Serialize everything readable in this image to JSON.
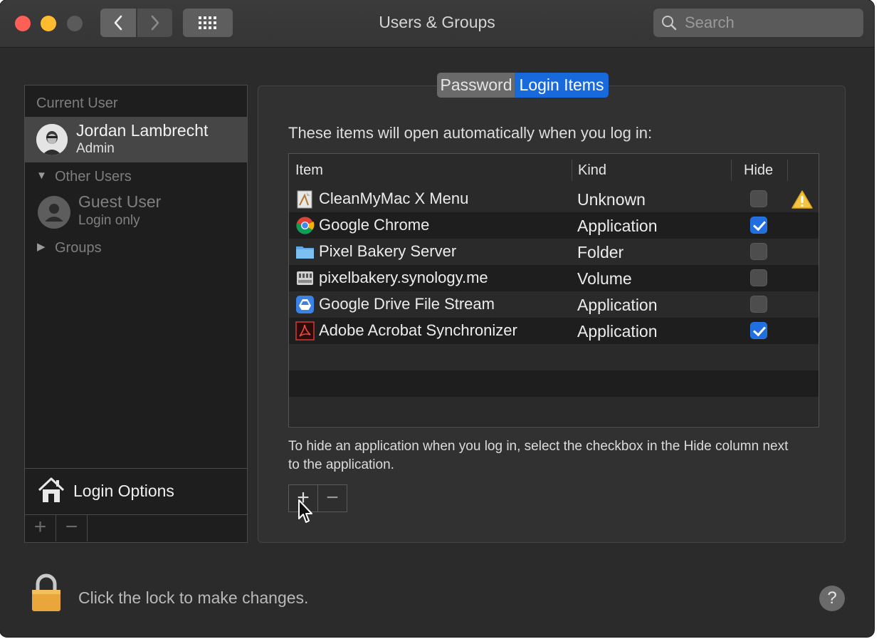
{
  "window": {
    "title": "Users & Groups"
  },
  "search": {
    "placeholder": "Search"
  },
  "sidebar": {
    "current_user_label": "Current User",
    "current_user": {
      "name": "Jordan Lambrecht",
      "role": "Admin"
    },
    "other_users_label": "Other Users",
    "guest": {
      "name": "Guest User",
      "subtitle": "Login only"
    },
    "groups_label": "Groups",
    "login_options_label": "Login Options",
    "add_label": "+",
    "remove_label": "−"
  },
  "tabs": [
    {
      "label": "Password",
      "selected": false
    },
    {
      "label": "Login Items",
      "selected": true
    }
  ],
  "main": {
    "intro": "These items will open automatically when you log in:",
    "columns": {
      "item": "Item",
      "kind": "Kind",
      "hide": "Hide"
    },
    "items": [
      {
        "name": "CleanMyMac X Menu",
        "kind": "Unknown",
        "hide": false,
        "icon": "cleanmymac-icon",
        "warning": true
      },
      {
        "name": "Google Chrome",
        "kind": "Application",
        "hide": true,
        "icon": "chrome-icon",
        "warning": false
      },
      {
        "name": "Pixel Bakery Server",
        "kind": "Folder",
        "hide": false,
        "icon": "folder-icon",
        "warning": false
      },
      {
        "name": "pixelbakery.synology.me",
        "kind": "Volume",
        "hide": false,
        "icon": "server-volume-icon",
        "warning": false
      },
      {
        "name": "Google Drive File Stream",
        "kind": "Application",
        "hide": false,
        "icon": "google-drive-icon",
        "warning": false
      },
      {
        "name": "Adobe Acrobat Synchronizer",
        "kind": "Application",
        "hide": true,
        "icon": "acrobat-icon",
        "warning": false
      }
    ],
    "hint": "To hide an application when you log in, select the checkbox in the Hide column next to the application.",
    "add_label": "+",
    "remove_label": "−"
  },
  "footer": {
    "lock_text": "Click the lock to make changes.",
    "help_label": "?"
  },
  "colors": {
    "accent": "#1769dc",
    "window_bg": "#2b2b2b",
    "close": "#fe5f57",
    "minimize": "#febc2e",
    "warning": "#f5c542"
  }
}
